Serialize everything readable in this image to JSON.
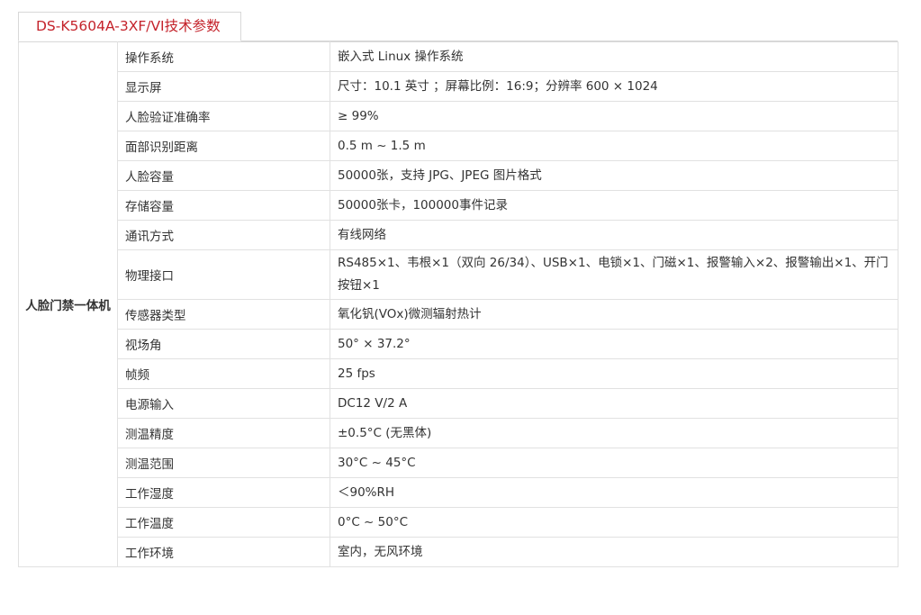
{
  "header": {
    "tab_title": "DS-K5604A-3XF/VI技术参数"
  },
  "table": {
    "category": "人脸门禁一体机",
    "rows": [
      {
        "label": "操作系统",
        "value": "嵌入式 Linux 操作系统"
      },
      {
        "label": "显示屏",
        "value": "尺寸：10.1 英寸 ；屏幕比例：16:9；分辨率 600 × 1024"
      },
      {
        "label": "人脸验证准确率",
        "value": "≥ 99%"
      },
      {
        "label": "面部识别距离",
        "value": "0.5 m ~ 1.5 m"
      },
      {
        "label": "人脸容量",
        "value": "50000张，支持 JPG、JPEG 图片格式"
      },
      {
        "label": "存储容量",
        "value": "50000张卡，100000事件记录"
      },
      {
        "label": "通讯方式",
        "value": "有线网络"
      },
      {
        "label": "物理接口",
        "value": "RS485×1、韦根×1（双向 26/34）、USB×1、电锁×1、门磁×1、报警输入×2、报警输出×1、开门按钮×1"
      },
      {
        "label": "传感器类型",
        "value": "氧化钒(VOx)微测辐射热计"
      },
      {
        "label": "视场角",
        "value": "50° × 37.2°"
      },
      {
        "label": "帧频",
        "value": "25 fps"
      },
      {
        "label": "电源输入",
        "value": "DC12 V/2 A"
      },
      {
        "label": "测温精度",
        "value": "±0.5°C (无黑体)"
      },
      {
        "label": "测温范围",
        "value": "30°C ~ 45°C"
      },
      {
        "label": "工作湿度",
        "value": "＜90%RH"
      },
      {
        "label": "工作温度",
        "value": "0°C ~ 50°C"
      },
      {
        "label": "工作环境",
        "value": "室内，无风环境"
      }
    ]
  },
  "colors": {
    "accent": "#c4232b",
    "border": "#e1e1e1",
    "text": "#333333"
  }
}
